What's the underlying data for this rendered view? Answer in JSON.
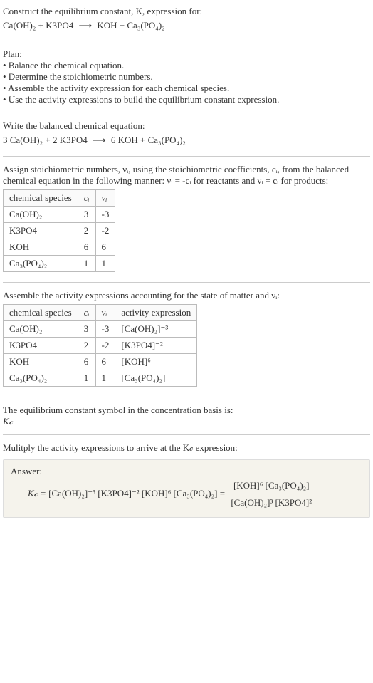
{
  "intro": {
    "line1": "Construct the equilibrium constant, K, expression for:",
    "eq_lhs": "Ca(OH)₂ + K3PO4",
    "arrow": "⟶",
    "eq_rhs": "KOH + Ca₃(PO₄)₂"
  },
  "plan": {
    "heading": "Plan:",
    "b1": "• Balance the chemical equation.",
    "b2": "• Determine the stoichiometric numbers.",
    "b3": "• Assemble the activity expression for each chemical species.",
    "b4": "• Use the activity expressions to build the equilibrium constant expression."
  },
  "balanced": {
    "heading": "Write the balanced chemical equation:",
    "eq_lhs": "3 Ca(OH)₂ + 2 K3PO4",
    "arrow": "⟶",
    "eq_rhs": "6 KOH + Ca₃(PO₄)₂"
  },
  "assign": {
    "text_before": "Assign stoichiometric numbers, νᵢ, using the stoichiometric coefficients, cᵢ, from the balanced chemical equation in the following manner: νᵢ = -cᵢ for reactants and νᵢ = cᵢ for products:",
    "h1": "chemical species",
    "h2": "cᵢ",
    "h3": "νᵢ",
    "r1c1": "Ca(OH)₂",
    "r1c2": "3",
    "r1c3": "-3",
    "r2c1": "K3PO4",
    "r2c2": "2",
    "r2c3": "-2",
    "r3c1": "KOH",
    "r3c2": "6",
    "r3c3": "6",
    "r4c1": "Ca₃(PO₄)₂",
    "r4c2": "1",
    "r4c3": "1"
  },
  "activity": {
    "heading": "Assemble the activity expressions accounting for the state of matter and νᵢ:",
    "h1": "chemical species",
    "h2": "cᵢ",
    "h3": "νᵢ",
    "h4": "activity expression",
    "r1c1": "Ca(OH)₂",
    "r1c2": "3",
    "r1c3": "-3",
    "r1c4": "[Ca(OH)₂]⁻³",
    "r2c1": "K3PO4",
    "r2c2": "2",
    "r2c3": "-2",
    "r2c4": "[K3PO4]⁻²",
    "r3c1": "KOH",
    "r3c2": "6",
    "r3c3": "6",
    "r3c4": "[KOH]⁶",
    "r4c1": "Ca₃(PO₄)₂",
    "r4c2": "1",
    "r4c3": "1",
    "r4c4": "[Ca₃(PO₄)₂]"
  },
  "symbol": {
    "line1": "The equilibrium constant symbol in the concentration basis is:",
    "line2": "K𝒸"
  },
  "multiply": {
    "line": "Mulitply the activity expressions to arrive at the K𝒸 expression:"
  },
  "answer": {
    "label": "Answer:",
    "kc": "K𝒸 = ",
    "prod": "[Ca(OH)₂]⁻³ [K3PO4]⁻² [KOH]⁶ [Ca₃(PO₄)₂] = ",
    "num": "[KOH]⁶ [Ca₃(PO₄)₂]",
    "den": "[Ca(OH)₂]³ [K3PO4]²"
  },
  "chart_data": null
}
